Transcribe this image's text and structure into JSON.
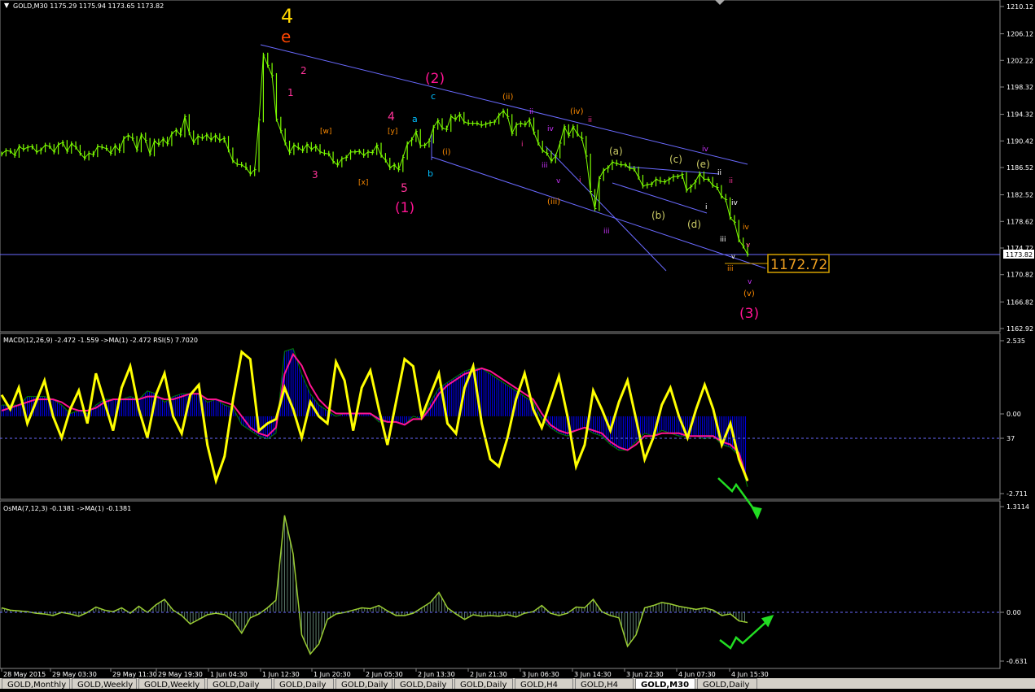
{
  "window": {
    "symbol_header": "GOLD,M30  1175.29 1175.94 1173.65 1173.82",
    "current_price_tag": "1173.82",
    "bid_price_box": "1172.72",
    "colors": {
      "background": "#000000",
      "price": "#7CFC00",
      "grid_line": "#4a4aff",
      "macd_fill": "#0000ff",
      "signal": "#ff1493",
      "rsi": "#ffff00",
      "osma": "#7f9a3a",
      "arrow": "#22dd22"
    }
  },
  "chart_data": [
    {
      "type": "line",
      "panel": "price",
      "title": "GOLD,M30  1175.29 1175.94 1173.65 1173.82",
      "ylim": [
        1162.92,
        1210.12
      ],
      "yticks": [
        "1210.12",
        "1206.12",
        "1202.22",
        "1198.32",
        "1194.32",
        "1190.42",
        "1186.52",
        "1182.52",
        "1178.62",
        "1174.72",
        "1170.82",
        "1166.82",
        "1162.92"
      ],
      "series": [
        {
          "values": [
            1188.5,
            1189.0,
            1188.9,
            1188.3,
            1189.6,
            1189.2,
            1189.5,
            1189.6,
            1188.8,
            1189.1,
            1189.8,
            1189.6,
            1188.8,
            1189.9,
            1190.2,
            1188.9,
            1190.0,
            1189.5,
            1188.6,
            1187.9,
            1188.6,
            1188.4,
            1189.6,
            1189.5,
            1189.3,
            1188.6,
            1189.7,
            1189.0,
            1190.8,
            1191.2,
            1190.8,
            1189.1,
            1191.3,
            1190.5,
            1188.5,
            1190.4,
            1189.9,
            1190.7,
            1190.0,
            1191.5,
            1192.0,
            1191.3,
            1194.0,
            1191.6,
            1190.2,
            1191.1,
            1190.8,
            1191.3,
            1190.6,
            1191.2,
            1190.5,
            1190.8,
            1189.1,
            1187.5,
            1187.0,
            1186.9,
            1186.5,
            1185.6,
            1186.2,
            1193.5,
            1203.0,
            1201.5,
            1200.0,
            1193.6,
            1191.9,
            1190.1,
            1188.7,
            1189.8,
            1189.4,
            1189.0,
            1189.9,
            1189.2,
            1189.6,
            1188.8,
            1188.6,
            1188.5,
            1187.4,
            1186.9,
            1187.8,
            1188.0,
            1188.8,
            1188.8,
            1188.9,
            1188.3,
            1188.8,
            1188.7,
            1189.8,
            1188.3,
            1187.6,
            1186.5,
            1186.9,
            1186.2,
            1188.0,
            1190.0,
            1190.6,
            1191.8,
            1189.7,
            1189.8,
            1190.4,
            1192.4,
            1193.4,
            1192.3,
            1192.1,
            1194.0,
            1193.6,
            1194.3,
            1193.2,
            1193.0,
            1193.0,
            1193.0,
            1192.7,
            1192.9,
            1193.1,
            1193.2,
            1194.2,
            1194.8,
            1194.0,
            1191.5,
            1192.8,
            1193.0,
            1192.8,
            1193.5,
            1191.7,
            1190.1,
            1189.0,
            1188.6,
            1187.5,
            1188.2,
            1190.1,
            1192.5,
            1191.2,
            1192.5,
            1191.4,
            1190.8,
            1188.2,
            1183.0,
            1180.5,
            1184.9,
            1186.1,
            1186.5,
            1187.3,
            1187.1,
            1186.9,
            1186.9,
            1186.4,
            1186.3,
            1185.1,
            1183.8,
            1184.0,
            1184.1,
            1184.8,
            1184.5,
            1184.4,
            1184.8,
            1185.2,
            1185.2,
            1185.5,
            1183.2,
            1183.7,
            1184.4,
            1185.6,
            1184.8,
            1184.8,
            1183.9,
            1183.6,
            1182.3,
            1181.8,
            1179.2,
            1178.5,
            1175.9,
            1175.0,
            1173.8
          ]
        }
      ]
    },
    {
      "type": "line",
      "panel": "macd_rsi",
      "title": "MACD(12,26,9) -2.472 -1.559  ->MA(1) -2.472  RSI(5) 7.7020",
      "ylim": [
        -2.711,
        2.535
      ],
      "yticks": [
        "2.535",
        "0.00",
        "37",
        "-2.711"
      ],
      "series": [
        {
          "name": "MACD",
          "values": [
            0.4,
            0.4,
            0.4,
            0.7,
            0.7,
            0.7,
            0.6,
            0.4,
            0.1,
            0.2,
            0.1,
            0.4,
            0.6,
            0.6,
            0.6,
            0.7,
            0.6,
            0.9,
            0.8,
            0.5,
            0.7,
            0.8,
            0.8,
            0.8,
            0.5,
            0.6,
            0.4,
            0.3,
            -0.3,
            -0.5,
            -0.7,
            -0.8,
            -0.6,
            2.3,
            2.4,
            1.5,
            0.8,
            0.4,
            0.2,
            0.0,
            0.1,
            0.1,
            0.1,
            0.1,
            -0.2,
            -0.2,
            -0.2,
            -0.3,
            0.0,
            -0.1,
            0.5,
            1.0,
            1.2,
            1.4,
            1.6,
            1.7,
            1.7,
            1.5,
            1.3,
            1.1,
            0.9,
            0.7,
            0.5,
            -0.1,
            -0.4,
            -0.6,
            -0.7,
            -0.5,
            -0.4,
            -0.6,
            -0.7,
            -1.0,
            -1.2,
            -1.2,
            -0.9,
            -0.6,
            -0.7,
            -0.5,
            -0.6,
            -0.7,
            -0.7,
            -0.7,
            -0.8,
            -0.7,
            -1.0,
            -1.1,
            -1.4,
            -2.5
          ]
        },
        {
          "name": "Signal",
          "values": [
            0.2,
            0.3,
            0.4,
            0.5,
            0.6,
            0.6,
            0.6,
            0.5,
            0.3,
            0.2,
            0.2,
            0.3,
            0.5,
            0.6,
            0.6,
            0.6,
            0.6,
            0.7,
            0.7,
            0.6,
            0.6,
            0.7,
            0.8,
            0.8,
            0.6,
            0.6,
            0.5,
            0.4,
            0.0,
            -0.4,
            -0.6,
            -0.7,
            -0.4,
            1.5,
            2.2,
            1.8,
            1.1,
            0.6,
            0.3,
            0.1,
            0.1,
            0.1,
            0.1,
            0.1,
            -0.1,
            -0.2,
            -0.2,
            -0.3,
            -0.1,
            -0.1,
            0.3,
            0.8,
            1.1,
            1.3,
            1.5,
            1.6,
            1.7,
            1.6,
            1.4,
            1.2,
            1.0,
            0.8,
            0.6,
            0.1,
            -0.3,
            -0.5,
            -0.6,
            -0.5,
            -0.4,
            -0.5,
            -0.6,
            -0.9,
            -1.1,
            -1.2,
            -1.0,
            -0.7,
            -0.7,
            -0.6,
            -0.6,
            -0.6,
            -0.7,
            -0.7,
            -0.7,
            -0.7,
            -0.9,
            -1.0,
            -1.3,
            -2.3
          ]
        },
        {
          "name": "RSI",
          "values": [
            65,
            55,
            70,
            45,
            60,
            75,
            50,
            35,
            55,
            68,
            45,
            80,
            60,
            40,
            70,
            85,
            55,
            35,
            65,
            80,
            50,
            38,
            65,
            72,
            30,
            5,
            22,
            62,
            95,
            90,
            40,
            45,
            48,
            70,
            55,
            35,
            60,
            50,
            45,
            88,
            75,
            40,
            70,
            82,
            55,
            30,
            60,
            90,
            85,
            50,
            65,
            80,
            45,
            38,
            70,
            85,
            45,
            20,
            15,
            35,
            62,
            80,
            55,
            42,
            60,
            78,
            50,
            15,
            30,
            68,
            55,
            40,
            60,
            75,
            48,
            20,
            35,
            58,
            70,
            50,
            35,
            55,
            72,
            55,
            30,
            45,
            20,
            5
          ]
        }
      ]
    },
    {
      "type": "bar",
      "panel": "osma",
      "title": "OsMA(7,12,3) -0.1381  ->MA(1) -0.1381",
      "ylim": [
        -0.631,
        1.3114
      ],
      "yticks": [
        "1.3114",
        "0.00",
        "-0.631"
      ],
      "series": [
        {
          "name": "OsMA",
          "values": [
            0.05,
            0.02,
            0.01,
            0.0,
            -0.02,
            -0.03,
            -0.05,
            -0.01,
            -0.03,
            -0.06,
            -0.01,
            0.06,
            0.02,
            0.0,
            0.05,
            -0.02,
            0.07,
            -0.01,
            0.09,
            0.16,
            0.02,
            -0.05,
            -0.16,
            -0.1,
            -0.04,
            -0.02,
            -0.04,
            -0.12,
            -0.28,
            -0.08,
            -0.03,
            0.05,
            0.15,
            1.25,
            0.75,
            -0.3,
            -0.55,
            -0.42,
            -0.1,
            -0.03,
            -0.01,
            0.02,
            0.05,
            0.04,
            0.08,
            0.01,
            -0.05,
            -0.05,
            -0.02,
            0.05,
            0.12,
            0.25,
            0.05,
            -0.03,
            -0.1,
            -0.04,
            -0.06,
            -0.05,
            -0.06,
            -0.04,
            -0.07,
            -0.02,
            0.0,
            0.08,
            -0.02,
            -0.05,
            -0.02,
            0.06,
            0.05,
            0.16,
            0.0,
            -0.05,
            -0.08,
            -0.45,
            -0.3,
            0.05,
            0.08,
            0.12,
            0.1,
            0.07,
            0.05,
            0.03,
            0.05,
            0.02,
            -0.05,
            -0.03,
            -0.12,
            -0.14
          ]
        }
      ]
    }
  ],
  "time_axis": [
    "28 May 2015",
    "29 May 03:30",
    "29 May 11:30",
    "29 May 19:30",
    "1 Jun 04:30",
    "1 Jun 12:30",
    "1 Jun 20:30",
    "2 Jun 05:30",
    "2 Jun 13:30",
    "2 Jun 21:30",
    "3 Jun 06:30",
    "3 Jun 14:30",
    "3 Jun 22:30",
    "4 Jun 07:30",
    "4 Jun 15:30"
  ],
  "annotations": {
    "wave_4": "4",
    "wave_e": "e",
    "wave_1_small": "1",
    "wave_2_small": "2",
    "wave_3_small": "3",
    "wave_4_small": "4",
    "wave_5_small": "5",
    "wave_w": "[w]",
    "wave_x": "[x]",
    "wave_y": "[y]",
    "wave_1_paren": "(1)",
    "wave_2_paren": "(2)",
    "wave_3_paren": "(3)",
    "wave_a": "a",
    "wave_b": "b",
    "wave_c": "c",
    "wave_i_paren": "(i)",
    "wave_ii_paren": "(ii)",
    "wave_iii_paren": "(iii)",
    "wave_iv_paren": "(iv)",
    "wave_v_paren": "(v)",
    "wave_a_paren": "(a)",
    "wave_b_paren": "(b)",
    "wave_c_paren": "(c)",
    "wave_d_paren": "(d)",
    "wave_e_paren": "(e)",
    "roman_i": "i",
    "roman_ii": "ii",
    "roman_iii": "iii",
    "roman_iv": "iv",
    "roman_v": "v"
  },
  "tabs": [
    "GOLD,Monthly",
    "GOLD,Weekly",
    "GOLD,Weekly",
    "GOLD,Daily",
    "GOLD,Daily",
    "GOLD,Daily",
    "GOLD,Daily",
    "GOLD,Daily",
    "GOLD,H4",
    "GOLD,H4",
    "GOLD,M30",
    "GOLD,Daily"
  ]
}
